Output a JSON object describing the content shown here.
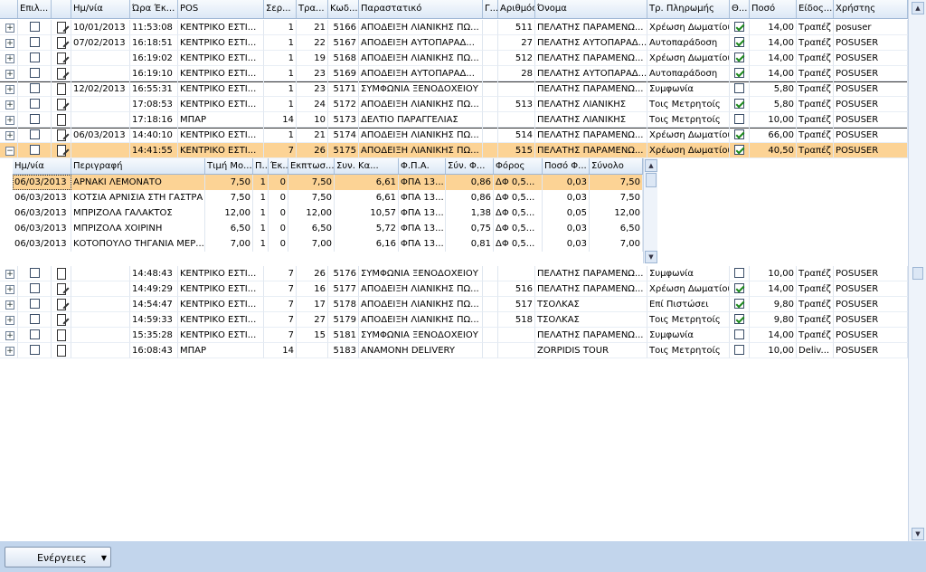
{
  "columns": [
    "Επιλ...",
    "",
    "Ημ/νία",
    "Ώρα Έκ...",
    "POS",
    "Σερ...",
    "Τρα...",
    "Κωδ...",
    "Παραστατικό",
    "Γ...",
    "Αριθμός",
    "Όνομα",
    "Τρ. Πληρωμής",
    "Θ...",
    "Ποσό",
    "Είδος...",
    "Χρήστης"
  ],
  "rows": [
    {
      "sel": false,
      "sep": false,
      "sign": "+",
      "chk": false,
      "icon": "pen",
      "date": "10/01/2013",
      "time": "11:53:08",
      "pos": "ΚΕΝΤΡΙΚΟ ΕΣΤΙ...",
      "ser": "1",
      "tra": "21",
      "code": "5166",
      "doc": "ΑΠΟΔΕΙΞΗ ΛΙΑΝΙΚΗΣ ΠΩ...",
      "g": "",
      "num": "511",
      "name": "ΠΕΛΑΤΗΣ ΠΑΡΑΜΕΝΩ...",
      "pay": "Χρέωση Δωματίου",
      "th": true,
      "amt": "14,00",
      "kind": "Τραπέζ",
      "user": "posuser"
    },
    {
      "sel": false,
      "sep": false,
      "sign": "+",
      "chk": false,
      "icon": "pen",
      "date": "07/02/2013",
      "time": "16:18:51",
      "pos": "ΚΕΝΤΡΙΚΟ ΕΣΤΙ...",
      "ser": "1",
      "tra": "22",
      "code": "5167",
      "doc": "ΑΠΟΔΕΙΞΗ ΑΥΤΟΠΑΡΑΔ...",
      "g": "",
      "num": "27",
      "name": "ΠΕΛΑΤΗΣ ΑΥΤΟΠΑΡΑΔ...",
      "pay": "Αυτοπαράδοση",
      "th": true,
      "amt": "14,00",
      "kind": "Τραπέζ",
      "user": "POSUSER"
    },
    {
      "sel": false,
      "sep": false,
      "sign": "+",
      "chk": false,
      "icon": "pen",
      "date": "",
      "time": "16:19:02",
      "pos": "ΚΕΝΤΡΙΚΟ ΕΣΤΙ...",
      "ser": "1",
      "tra": "19",
      "code": "5168",
      "doc": "ΑΠΟΔΕΙΞΗ ΛΙΑΝΙΚΗΣ ΠΩ...",
      "g": "",
      "num": "512",
      "name": "ΠΕΛΑΤΗΣ ΠΑΡΑΜΕΝΩ...",
      "pay": "Χρέωση Δωματίου",
      "th": true,
      "amt": "14,00",
      "kind": "Τραπέζ",
      "user": "POSUSER"
    },
    {
      "sel": false,
      "sep": false,
      "sign": "+",
      "chk": false,
      "icon": "pen",
      "date": "",
      "time": "16:19:10",
      "pos": "ΚΕΝΤΡΙΚΟ ΕΣΤΙ...",
      "ser": "1",
      "tra": "23",
      "code": "5169",
      "doc": "ΑΠΟΔΕΙΞΗ ΑΥΤΟΠΑΡΑΔ...",
      "g": "",
      "num": "28",
      "name": "ΠΕΛΑΤΗΣ ΑΥΤΟΠΑΡΑΔ...",
      "pay": "Αυτοπαράδοση",
      "th": true,
      "amt": "14,00",
      "kind": "Τραπέζ",
      "user": "POSUSER"
    },
    {
      "sel": false,
      "sep": true,
      "sign": "+",
      "chk": false,
      "icon": "doc",
      "date": "12/02/2013",
      "time": "16:55:31",
      "pos": "ΚΕΝΤΡΙΚΟ ΕΣΤΙ...",
      "ser": "1",
      "tra": "23",
      "code": "5171",
      "doc": "ΣΥΜΦΩΝΙΑ ΞΕΝΟΔΟΧΕΙΟΥ",
      "g": "",
      "num": "",
      "name": "ΠΕΛΑΤΗΣ ΠΑΡΑΜΕΝΩ...",
      "pay": "Συμφωνία",
      "th": false,
      "amt": "5,80",
      "kind": "Τραπέζ",
      "user": "POSUSER"
    },
    {
      "sel": false,
      "sep": false,
      "sign": "+",
      "chk": false,
      "icon": "pen",
      "date": "",
      "time": "17:08:53",
      "pos": "ΚΕΝΤΡΙΚΟ ΕΣΤΙ...",
      "ser": "1",
      "tra": "24",
      "code": "5172",
      "doc": "ΑΠΟΔΕΙΞΗ ΛΙΑΝΙΚΗΣ ΠΩ...",
      "g": "",
      "num": "513",
      "name": "ΠΕΛΑΤΗΣ ΛΙΑΝΙΚΗΣ",
      "pay": "Τοις Μετρητοίς",
      "th": true,
      "amt": "5,80",
      "kind": "Τραπέζ",
      "user": "POSUSER"
    },
    {
      "sel": false,
      "sep": false,
      "sign": "+",
      "chk": false,
      "icon": "doc",
      "date": "",
      "time": "17:18:16",
      "pos": "ΜΠΑΡ",
      "ser": "14",
      "tra": "10",
      "code": "5173",
      "doc": "ΔΕΛΤΙΟ ΠΑΡΑΓΓΕΛΙΑΣ",
      "g": "",
      "num": "",
      "name": "ΠΕΛΑΤΗΣ ΛΙΑΝΙΚΗΣ",
      "pay": "Τοις Μετρητοίς",
      "th": false,
      "amt": "10,00",
      "kind": "Τραπέζ",
      "user": "POSUSER"
    },
    {
      "sel": false,
      "sep": true,
      "sign": "+",
      "chk": false,
      "icon": "pen",
      "date": "06/03/2013",
      "time": "14:40:10",
      "pos": "ΚΕΝΤΡΙΚΟ ΕΣΤΙ...",
      "ser": "1",
      "tra": "21",
      "code": "5174",
      "doc": "ΑΠΟΔΕΙΞΗ ΛΙΑΝΙΚΗΣ ΠΩ...",
      "g": "",
      "num": "514",
      "name": "ΠΕΛΑΤΗΣ ΠΑΡΑΜΕΝΩ...",
      "pay": "Χρέωση Δωματίου",
      "th": true,
      "amt": "66,00",
      "kind": "Τραπέζ",
      "user": "POSUSER"
    },
    {
      "sel": true,
      "sep": false,
      "sign": "−",
      "chk": false,
      "icon": "pen",
      "date": "",
      "time": "14:41:55",
      "pos": "ΚΕΝΤΡΙΚΟ ΕΣΤΙ...",
      "ser": "7",
      "tra": "26",
      "code": "5175",
      "doc": "ΑΠΟΔΕΙΞΗ ΛΙΑΝΙΚΗΣ ΠΩ...",
      "g": "",
      "num": "515",
      "name": "ΠΕΛΑΤΗΣ ΠΑΡΑΜΕΝΩ...",
      "pay": "Χρέωση Δωματίου",
      "th": true,
      "amt": "40,50",
      "kind": "Τραπέζ",
      "user": "POSUSER"
    }
  ],
  "rows2": [
    {
      "sel": false,
      "sep": false,
      "sign": "+",
      "chk": false,
      "icon": "doc",
      "date": "",
      "time": "14:48:43",
      "pos": "ΚΕΝΤΡΙΚΟ ΕΣΤΙ...",
      "ser": "7",
      "tra": "26",
      "code": "5176",
      "doc": "ΣΥΜΦΩΝΙΑ ΞΕΝΟΔΟΧΕΙΟΥ",
      "g": "",
      "num": "",
      "name": "ΠΕΛΑΤΗΣ ΠΑΡΑΜΕΝΩ...",
      "pay": "Συμφωνία",
      "th": false,
      "amt": "10,00",
      "kind": "Τραπέζ",
      "user": "POSUSER"
    },
    {
      "sel": false,
      "sep": false,
      "sign": "+",
      "chk": false,
      "icon": "pen",
      "date": "",
      "time": "14:49:29",
      "pos": "ΚΕΝΤΡΙΚΟ ΕΣΤΙ...",
      "ser": "7",
      "tra": "16",
      "code": "5177",
      "doc": "ΑΠΟΔΕΙΞΗ ΛΙΑΝΙΚΗΣ ΠΩ...",
      "g": "",
      "num": "516",
      "name": "ΠΕΛΑΤΗΣ ΠΑΡΑΜΕΝΩ...",
      "pay": "Χρέωση Δωματίου",
      "th": true,
      "amt": "14,00",
      "kind": "Τραπέζ",
      "user": "POSUSER"
    },
    {
      "sel": false,
      "sep": false,
      "sign": "+",
      "chk": false,
      "icon": "pen",
      "date": "",
      "time": "14:54:47",
      "pos": "ΚΕΝΤΡΙΚΟ ΕΣΤΙ...",
      "ser": "7",
      "tra": "17",
      "code": "5178",
      "doc": "ΑΠΟΔΕΙΞΗ ΛΙΑΝΙΚΗΣ ΠΩ...",
      "g": "",
      "num": "517",
      "name": "ΤΣΟΛΚΑΣ",
      "pay": "Επί Πιστώσει",
      "th": true,
      "amt": "9,80",
      "kind": "Τραπέζ",
      "user": "POSUSER"
    },
    {
      "sel": false,
      "sep": false,
      "sign": "+",
      "chk": false,
      "icon": "pen",
      "date": "",
      "time": "14:59:33",
      "pos": "ΚΕΝΤΡΙΚΟ ΕΣΤΙ...",
      "ser": "7",
      "tra": "27",
      "code": "5179",
      "doc": "ΑΠΟΔΕΙΞΗ ΛΙΑΝΙΚΗΣ ΠΩ...",
      "g": "",
      "num": "518",
      "name": "ΤΣΟΛΚΑΣ",
      "pay": "Τοις Μετρητοίς",
      "th": true,
      "amt": "9,80",
      "kind": "Τραπέζ",
      "user": "POSUSER"
    },
    {
      "sel": false,
      "sep": false,
      "sign": "+",
      "chk": false,
      "icon": "doc",
      "date": "",
      "time": "15:35:28",
      "pos": "ΚΕΝΤΡΙΚΟ ΕΣΤΙ...",
      "ser": "7",
      "tra": "15",
      "code": "5181",
      "doc": "ΣΥΜΦΩΝΙΑ ΞΕΝΟΔΟΧΕΙΟΥ",
      "g": "",
      "num": "",
      "name": "ΠΕΛΑΤΗΣ ΠΑΡΑΜΕΝΩ...",
      "pay": "Συμφωνία",
      "th": false,
      "amt": "14,00",
      "kind": "Τραπέζ",
      "user": "POSUSER"
    },
    {
      "sel": false,
      "sep": false,
      "sign": "+",
      "chk": false,
      "icon": "doc",
      "date": "",
      "time": "16:08:43",
      "pos": "ΜΠΑΡ",
      "ser": "14",
      "tra": "",
      "code": "5183",
      "doc": "ΑΝΑΜΟΝΗ DELIVERY",
      "g": "",
      "num": "",
      "name": "ZORPIDIS TOUR",
      "pay": "Τοις Μετρητοίς",
      "th": false,
      "amt": "10,00",
      "kind": "Deliv...",
      "user": "POSUSER"
    }
  ],
  "detail": {
    "columns": [
      "Ημ/νία",
      "Περιγραφή",
      "Τιμή Μο...",
      "Π...",
      "Έκ...",
      "Εκπτωσ...",
      "Συν. Κα...",
      "Φ.Π.Α.",
      "Σύν. Φ...",
      "Φόρος",
      "Ποσό Φ...",
      "Σύνολο"
    ],
    "rows": [
      {
        "sel": true,
        "date": "06/03/2013",
        "desc": "ΑΡΝΑΚΙ ΛΕΜΟΝΑΤΟ",
        "price": "7,50",
        "q": "1",
        "ek": "0",
        "disc": "7,50",
        "net": "6,61",
        "vat": "ΦΠΑ 13...",
        "vatamt": "0,86",
        "tax": "ΔΦ 0,5...",
        "taxamt": "0,03",
        "total": "7,50"
      },
      {
        "sel": false,
        "date": "06/03/2013",
        "desc": "ΚΟΤΣΙΑ ΑΡΝΙΣΙΑ ΣΤΗ ΓΑΣΤΡΑ",
        "price": "7,50",
        "q": "1",
        "ek": "0",
        "disc": "7,50",
        "net": "6,61",
        "vat": "ΦΠΑ 13...",
        "vatamt": "0,86",
        "tax": "ΔΦ 0,5...",
        "taxamt": "0,03",
        "total": "7,50"
      },
      {
        "sel": false,
        "date": "06/03/2013",
        "desc": "ΜΠΡΙΖΟΛΑ ΓΑΛΑΚΤΟΣ",
        "price": "12,00",
        "q": "1",
        "ek": "0",
        "disc": "12,00",
        "net": "10,57",
        "vat": "ΦΠΑ 13...",
        "vatamt": "1,38",
        "tax": "ΔΦ 0,5...",
        "taxamt": "0,05",
        "total": "12,00"
      },
      {
        "sel": false,
        "date": "06/03/2013",
        "desc": "ΜΠΡΙΖΟΛΑ ΧΟΙΡΙΝΗ",
        "price": "6,50",
        "q": "1",
        "ek": "0",
        "disc": "6,50",
        "net": "5,72",
        "vat": "ΦΠΑ 13...",
        "vatamt": "0,75",
        "tax": "ΔΦ 0,5...",
        "taxamt": "0,03",
        "total": "6,50"
      },
      {
        "sel": false,
        "date": "06/03/2013",
        "desc": "ΚΟΤΟΠΟΥΛΟ ΤΗΓΑΝΙΑ ΜΕΡ...",
        "price": "7,00",
        "q": "1",
        "ek": "0",
        "disc": "7,00",
        "net": "6,16",
        "vat": "ΦΠΑ 13...",
        "vatamt": "0,81",
        "tax": "ΔΦ 0,5...",
        "taxamt": "0,03",
        "total": "7,00"
      }
    ]
  },
  "footer": {
    "actions_label": "Ενέργειες"
  }
}
